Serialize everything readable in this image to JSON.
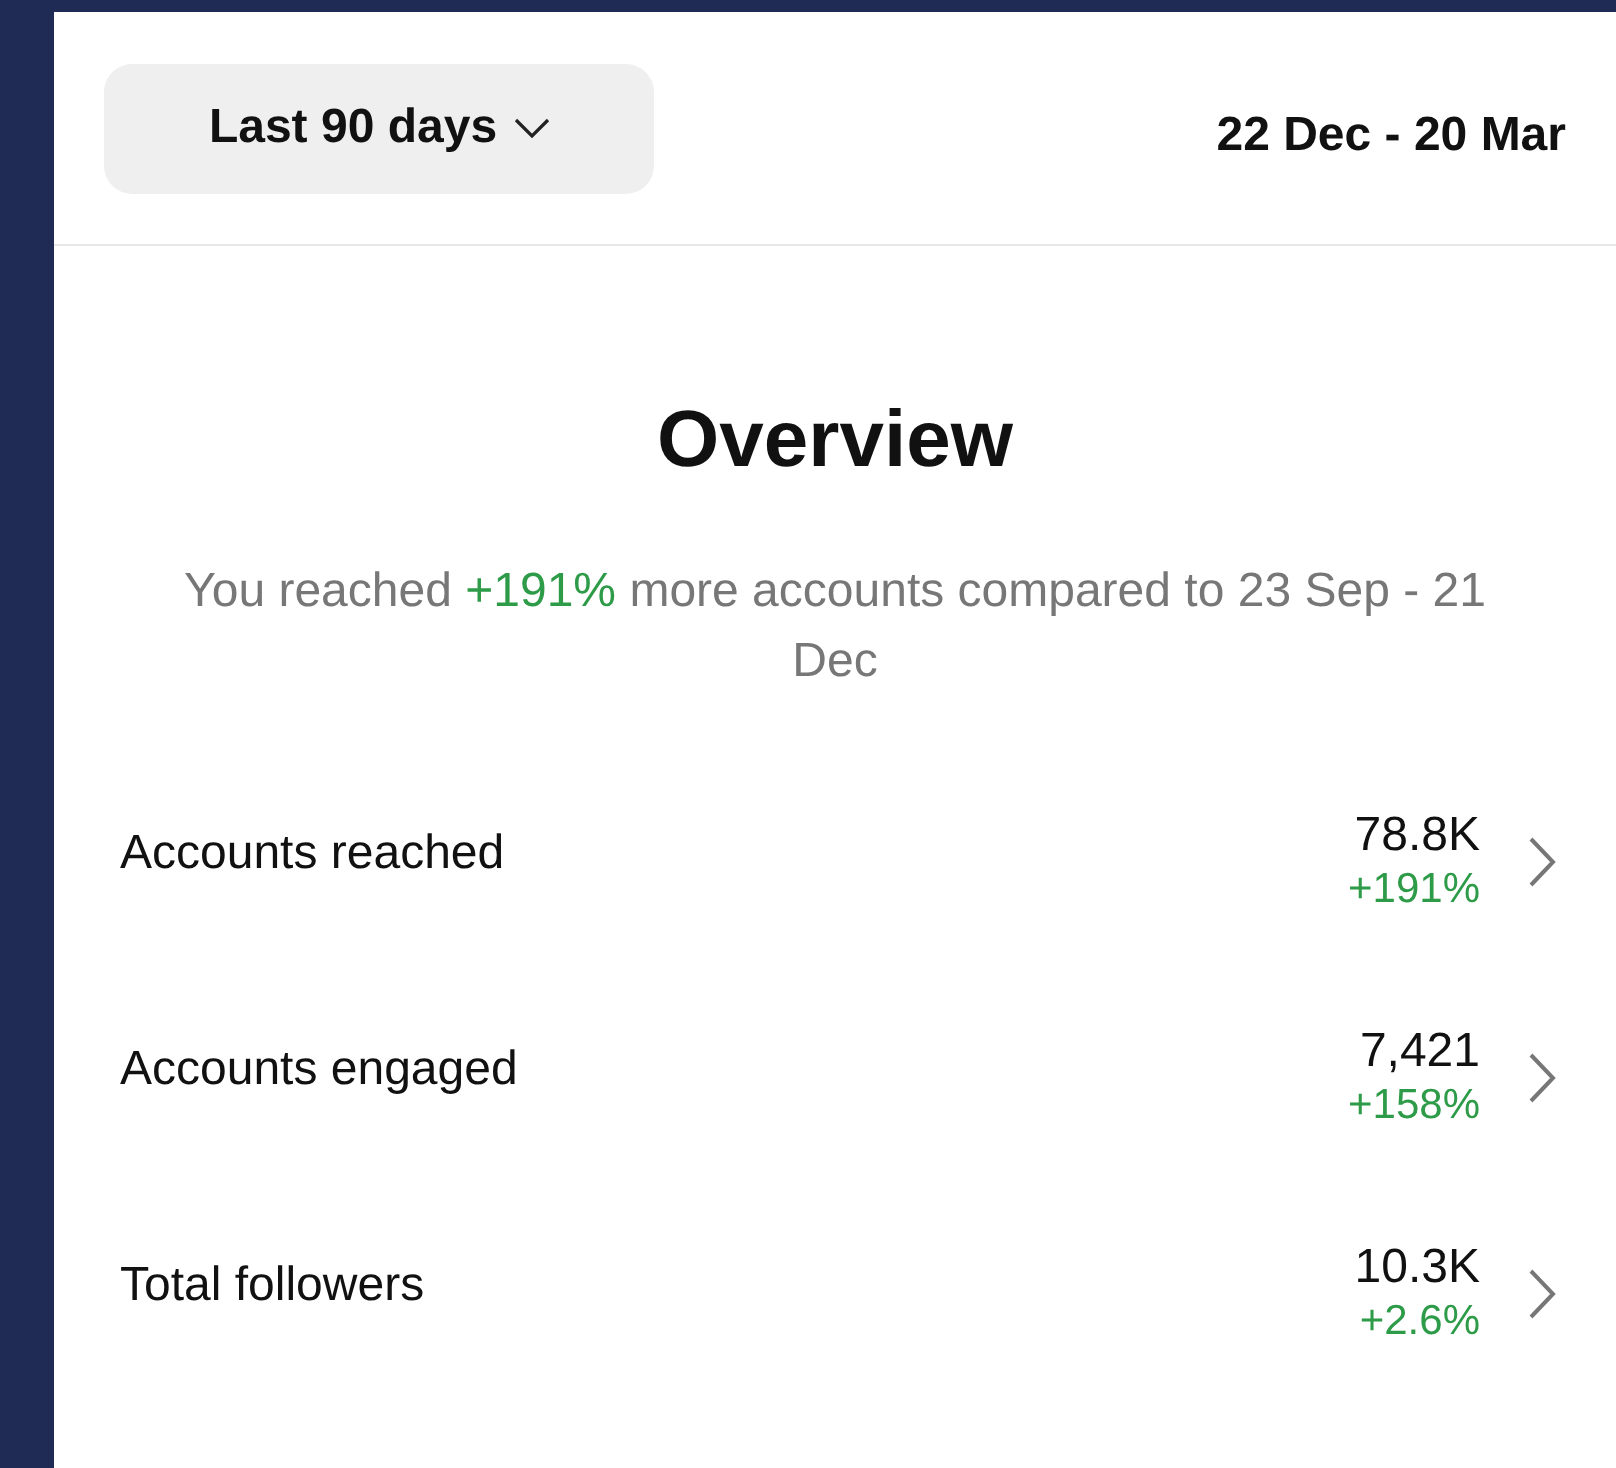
{
  "header": {
    "range_button": "Last 90 days",
    "date_range": "22 Dec - 20 Mar"
  },
  "overview": {
    "title": "Overview",
    "summary": [
      {
        "kind": "plain",
        "text": "You reached "
      },
      {
        "kind": "positive",
        "text": "+191%"
      },
      {
        "kind": "plain",
        "text": " more accounts compared to 23 Sep - 21 Dec"
      }
    ]
  },
  "metrics": [
    {
      "label": "Accounts reached",
      "value": "78.8K",
      "change": "+191%"
    },
    {
      "label": "Accounts engaged",
      "value": "7,421",
      "change": "+158%"
    },
    {
      "label": "Total followers",
      "value": "10.3K",
      "change": "+2.6%"
    }
  ]
}
